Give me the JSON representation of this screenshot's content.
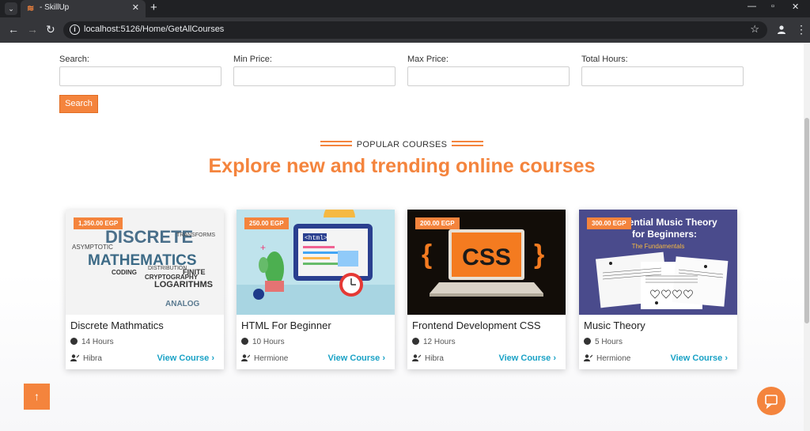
{
  "browser": {
    "tab_title": "- SkillUp",
    "url": "localhost:5126/Home/GetAllCourses"
  },
  "filters": {
    "search_label": "Search:",
    "min_price_label": "Min Price:",
    "max_price_label": "Max Price:",
    "total_hours_label": "Total Hours:",
    "search_button": "Search"
  },
  "section": {
    "subtitle": "POPULAR COURSES",
    "title": "Explore new and trending online courses"
  },
  "courses": [
    {
      "price": "1,350.00 EGP",
      "title": "Discrete Mathmatics",
      "hours": "14 Hours",
      "author": "Hibra",
      "link": "View Course ›",
      "thumb_words": [
        "DISCRETE",
        "MATHEMATICS",
        "ASYMPTOTIC",
        "CODING",
        "LOGARITHMS",
        "ANALOG",
        "FINITE",
        "TRANSFORMS",
        "CRYPTOGRAPHY",
        "DISTRIBUTION"
      ]
    },
    {
      "price": "250.00 EGP",
      "title": "HTML For Beginner",
      "hours": "10 Hours",
      "author": "Hermione",
      "link": "View Course ›",
      "thumb_words": [
        "<html>"
      ]
    },
    {
      "price": "200.00 EGP",
      "title": "Frontend Development CSS",
      "hours": "12 Hours",
      "author": "Hibra",
      "link": "View Course ›",
      "thumb_words": [
        "{",
        "CSS",
        "}"
      ]
    },
    {
      "price": "300.00 EGP",
      "title": "Music Theory",
      "hours": "5 Hours",
      "author": "Hermione",
      "link": "View Course ›",
      "thumb_words": [
        "Essential Music Theory",
        "for Beginners:",
        "The Fundamentals"
      ]
    }
  ],
  "colors": {
    "accent": "#f4843d",
    "link": "#1aa2c6"
  }
}
